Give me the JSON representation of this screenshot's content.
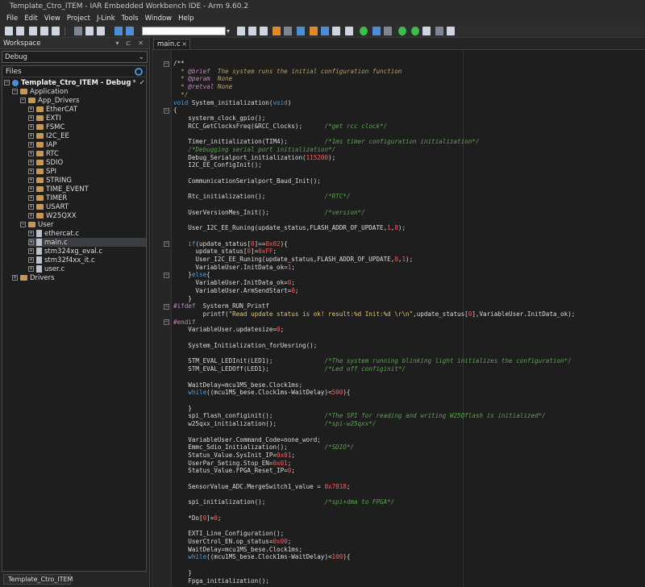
{
  "window": {
    "title": "Template_Ctro_ITEM - IAR Embedded Workbench IDE - Arm 9.60.2"
  },
  "menu": [
    "File",
    "Edit",
    "View",
    "Project",
    "J-Link",
    "Tools",
    "Window",
    "Help"
  ],
  "workspace": {
    "title": "Workspace",
    "header_controls": "▾ ⊏ ✕",
    "config": "Debug",
    "files_header": "Files",
    "project": "Template_Ctro_ITEM - Debug",
    "project_marker": "*",
    "project_check": "✓",
    "tab": "Template_Ctro_ITEM",
    "tree": {
      "application": "Application",
      "app_drivers": "App_Drivers",
      "drivers": [
        "EtherCAT",
        "EXTI",
        "FSMC",
        "I2C_EE",
        "IAP",
        "RTC",
        "SDIO",
        "SPI",
        "STRING",
        "TIME_EVENT",
        "TIMER",
        "USART",
        "W25QXX"
      ],
      "user": "User",
      "user_files": [
        "ethercat.c",
        "main.c",
        "stm324xg_eval.c",
        "stm32f4xx_it.c",
        "user.c"
      ],
      "drivers_root": "Drivers"
    }
  },
  "editor": {
    "tab": "main.c",
    "tab_close": "×",
    "lines": [
      [
        [
          "",
          "/**"
        ]
      ],
      [
        [
          "c-doc",
          "  * "
        ],
        [
          "c-tag",
          "@brief"
        ],
        [
          "c-doc",
          "  The system runs the initial configuration function"
        ]
      ],
      [
        [
          "c-doc",
          "  * "
        ],
        [
          "c-tag",
          "@param"
        ],
        [
          "c-doc",
          "  None"
        ]
      ],
      [
        [
          "c-doc",
          "  * "
        ],
        [
          "c-tag",
          "@retval"
        ],
        [
          "c-doc",
          " None"
        ]
      ],
      [
        [
          "c-doc",
          "  */"
        ]
      ],
      [
        [
          "c-kw",
          "void"
        ],
        [
          "",
          " System_initialization("
        ],
        [
          "c-kw",
          "void"
        ],
        [
          "",
          ")"
        ]
      ],
      [
        [
          "",
          "{"
        ]
      ],
      [
        [
          "",
          "    systerm_clock_gpio();"
        ]
      ],
      [
        [
          "",
          "    RCC_GetClocksFreq(&RCC_Clocks);      "
        ],
        [
          "c-com",
          "/*get rcc clock*/"
        ]
      ],
      [
        [
          "",
          ""
        ]
      ],
      [
        [
          "",
          "    Timer_initialization(TIM4);          "
        ],
        [
          "c-com",
          "/*1ms timer configuration initialization*/"
        ]
      ],
      [
        [
          "c-com",
          "    /*Debugging serial port initialization*/"
        ]
      ],
      [
        [
          "",
          "    Debug_Serialport_initialization("
        ],
        [
          "c-num",
          "115200"
        ],
        [
          "",
          ");"
        ]
      ],
      [
        [
          "",
          "    I2C_EE_ConfigInit();"
        ]
      ],
      [
        [
          "",
          ""
        ]
      ],
      [
        [
          "",
          "    CommunicationSerialport_Baud_Init();"
        ]
      ],
      [
        [
          "",
          ""
        ]
      ],
      [
        [
          "",
          "    Rtc_initialization();                "
        ],
        [
          "c-com",
          "/*RTC*/"
        ]
      ],
      [
        [
          "",
          ""
        ]
      ],
      [
        [
          "",
          "    UserVersionMes_Init();               "
        ],
        [
          "c-com",
          "/*version*/"
        ]
      ],
      [
        [
          "",
          ""
        ]
      ],
      [
        [
          "",
          "    User_I2C_EE_Runing(update_status,FLASH_ADDR_OF_UPDATE,"
        ],
        [
          "c-num",
          "1"
        ],
        [
          "",
          ","
        ],
        [
          "c-num",
          "8"
        ],
        [
          "",
          ");"
        ]
      ],
      [
        [
          "",
          ""
        ]
      ],
      [
        [
          "",
          "    "
        ],
        [
          "c-kw",
          "if"
        ],
        [
          "",
          "(update_status["
        ],
        [
          "c-num",
          "0"
        ],
        [
          "",
          "]=="
        ],
        [
          "c-num",
          "0x02"
        ],
        [
          "",
          "){"
        ]
      ],
      [
        [
          "",
          "      update_status["
        ],
        [
          "c-num",
          "0"
        ],
        [
          "",
          "]="
        ],
        [
          "c-num",
          "0xFF"
        ],
        [
          "",
          ";"
        ]
      ],
      [
        [
          "",
          "      User_I2C_EE_Runing(update_status,FLASH_ADDR_OF_UPDATE,"
        ],
        [
          "c-num",
          "0"
        ],
        [
          "",
          ","
        ],
        [
          "c-num",
          "1"
        ],
        [
          "",
          ");"
        ]
      ],
      [
        [
          "",
          "      VariableUser.InitData_ok="
        ],
        [
          "c-num",
          "1"
        ],
        [
          "",
          ";"
        ]
      ],
      [
        [
          "",
          "    }"
        ],
        [
          "c-kw",
          "else"
        ],
        [
          "",
          "{"
        ]
      ],
      [
        [
          "",
          "      VariableUser.InitData_ok="
        ],
        [
          "c-num",
          "0"
        ],
        [
          "",
          ";"
        ]
      ],
      [
        [
          "",
          "      VariableUser.ArmSendStart="
        ],
        [
          "c-num",
          "0"
        ],
        [
          "",
          ";"
        ]
      ],
      [
        [
          "",
          "    }"
        ]
      ],
      [
        [
          "c-pp",
          "#ifdef"
        ],
        [
          "",
          "  Systerm_RUN_Printf"
        ]
      ],
      [
        [
          "",
          "        printf("
        ],
        [
          "c-str",
          "\"Read update status is ok! result:%d Init:%d \\r\\n\""
        ],
        [
          "",
          ",update_status["
        ],
        [
          "c-num",
          "0"
        ],
        [
          "",
          "],VariableUser.InitData_ok);"
        ]
      ],
      [
        [
          "c-pp",
          "#endif"
        ]
      ],
      [
        [
          "",
          "    VariableUser.updatesize="
        ],
        [
          "c-num",
          "0"
        ],
        [
          "",
          ";"
        ]
      ],
      [
        [
          "",
          ""
        ]
      ],
      [
        [
          "",
          "    System_Initialization_forUesring();"
        ]
      ],
      [
        [
          "",
          ""
        ]
      ],
      [
        [
          "",
          "    STM_EVAL_LEDInit(LED1);              "
        ],
        [
          "c-com",
          "/*The system running blinking light initializes the configuration*/"
        ]
      ],
      [
        [
          "",
          "    STM_EVAL_LEDOff(LED1);               "
        ],
        [
          "c-com",
          "/*Led off configinit*/"
        ]
      ],
      [
        [
          "",
          ""
        ]
      ],
      [
        [
          "",
          "    WaitDelay=mcu1MS_bese.Clock1ms;"
        ]
      ],
      [
        [
          "",
          "    "
        ],
        [
          "c-kw",
          "while"
        ],
        [
          "",
          "((mcu1MS_bese.Clock1ms-WaitDelay)<"
        ],
        [
          "c-num",
          "500"
        ],
        [
          "",
          "){"
        ]
      ],
      [
        [
          "",
          ""
        ]
      ],
      [
        [
          "",
          "    }"
        ]
      ],
      [
        [
          "",
          "    spi_flash_configinit();              "
        ],
        [
          "c-com",
          "/*The SPI for reading and writing W25Qflash is initialized*/"
        ]
      ],
      [
        [
          "",
          "    w25qxx_initialization();             "
        ],
        [
          "c-com",
          "/*spi-w25qxx*/"
        ]
      ],
      [
        [
          "",
          ""
        ]
      ],
      [
        [
          "",
          "    VariableUser.Command_Code=none_word;"
        ]
      ],
      [
        [
          "",
          "    Emmc_Sdio_Initialization();          "
        ],
        [
          "c-com",
          "/*SDIO*/"
        ]
      ],
      [
        [
          "",
          "    Status_Value.SysInit_IP="
        ],
        [
          "c-num",
          "0x01"
        ],
        [
          "",
          ";"
        ]
      ],
      [
        [
          "",
          "    UserPar_Seting.Stop_EN="
        ],
        [
          "c-num",
          "0x01"
        ],
        [
          "",
          ";"
        ]
      ],
      [
        [
          "",
          "    Status_Value.FPGA_Reset_IP="
        ],
        [
          "c-num",
          "0"
        ],
        [
          "",
          ";"
        ]
      ],
      [
        [
          "",
          ""
        ]
      ],
      [
        [
          "",
          "    SensorValue_ADC.MergeSwitch1_value = "
        ],
        [
          "c-num",
          "0x7818"
        ],
        [
          "",
          ";"
        ]
      ],
      [
        [
          "",
          ""
        ]
      ],
      [
        [
          "",
          "    spi_initialization();                "
        ],
        [
          "c-com",
          "/*spi+dma to FPGA*/"
        ]
      ],
      [
        [
          "",
          ""
        ]
      ],
      [
        [
          "",
          "    *Do["
        ],
        [
          "c-num",
          "0"
        ],
        [
          "",
          "]="
        ],
        [
          "c-num",
          "0"
        ],
        [
          "",
          ";"
        ]
      ],
      [
        [
          "",
          ""
        ]
      ],
      [
        [
          "",
          "    EXTI_Line_Configuration();"
        ]
      ],
      [
        [
          "",
          "    UserCtrol_EN.op_status="
        ],
        [
          "c-num",
          "0x00"
        ],
        [
          "",
          ";"
        ]
      ],
      [
        [
          "",
          "    WaitDelay=mcu1MS_bese.Clock1ms;"
        ]
      ],
      [
        [
          "",
          "    "
        ],
        [
          "c-kw",
          "while"
        ],
        [
          "",
          "((mcu1MS_bese.Clock1ms-WaitDelay)<"
        ],
        [
          "c-num",
          "100"
        ],
        [
          "",
          "){"
        ]
      ],
      [
        [
          "",
          ""
        ]
      ],
      [
        [
          "",
          "    }"
        ]
      ],
      [
        [
          "",
          "    Fpga_initialization();"
        ]
      ]
    ]
  }
}
